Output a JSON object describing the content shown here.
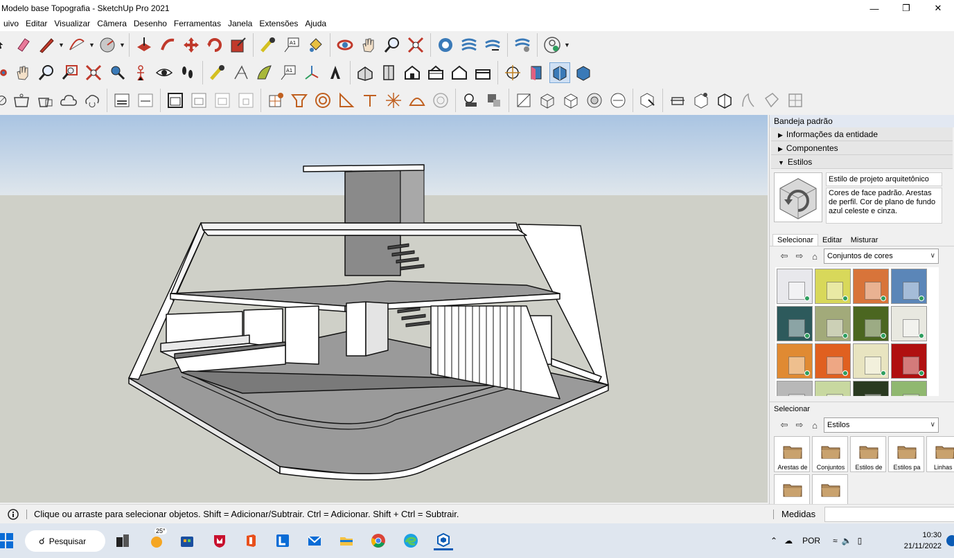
{
  "window": {
    "title": "Modelo base Topografia - SketchUp Pro 2021",
    "minimize_icon": "minimize-icon",
    "restore_icon": "restore-icon",
    "close_icon": "close-icon"
  },
  "menu": [
    "uivo",
    "Editar",
    "Visualizar",
    "Câmera",
    "Desenho",
    "Ferramentas",
    "Janela",
    "Extensões",
    "Ajuda"
  ],
  "tray": {
    "title": "Bandeja padrão",
    "panels": [
      "Informações da entidade",
      "Componentes",
      "Estilos"
    ],
    "style": {
      "name": "Estilo de projeto arquitetônico",
      "description": "Cores de face padrão. Arestas de perfil. Cor de plano de fundo azul celeste e cinza."
    },
    "tabs": [
      "Selecionar",
      "Editar",
      "Misturar"
    ],
    "collection_top": "Conjuntos de cores",
    "select_label": "Selecionar",
    "collection_bottom": "Estilos",
    "swatch_colors": [
      "#e8e8ec",
      "#d8d85a",
      "#d8743a",
      "#5b86b8",
      "#2d5a5c",
      "#a2aa7a",
      "#4b6620",
      "#e8e8e0",
      "#e08a32",
      "#e06020",
      "#e8e4c0",
      "#b01010",
      "#b8b8b8",
      "#c8d8a0",
      "#2a3a20",
      "#90b870"
    ],
    "folders": [
      "Arestas de",
      "Conjuntos",
      "Estilos de",
      "Estilos pa",
      "Linhas r",
      "",
      ""
    ]
  },
  "status": {
    "info_icon": "info-icon",
    "message": "Clique ou arraste para selecionar objetos. Shift = Adicionar/Subtrair. Ctrl = Adicionar. Shift + Ctrl = Subtrair.",
    "measures_label": "Medidas",
    "measures_value": ""
  },
  "taskbar": {
    "search_placeholder": "Pesquisar",
    "weather": "25°",
    "language": "POR",
    "time": "10:30",
    "date": "21/11/2022"
  },
  "colors": {
    "sky": "#bfd3e8",
    "ground": "#cfd0c8",
    "floor": "#8d8d8d",
    "accent": "#0a5bb5"
  }
}
